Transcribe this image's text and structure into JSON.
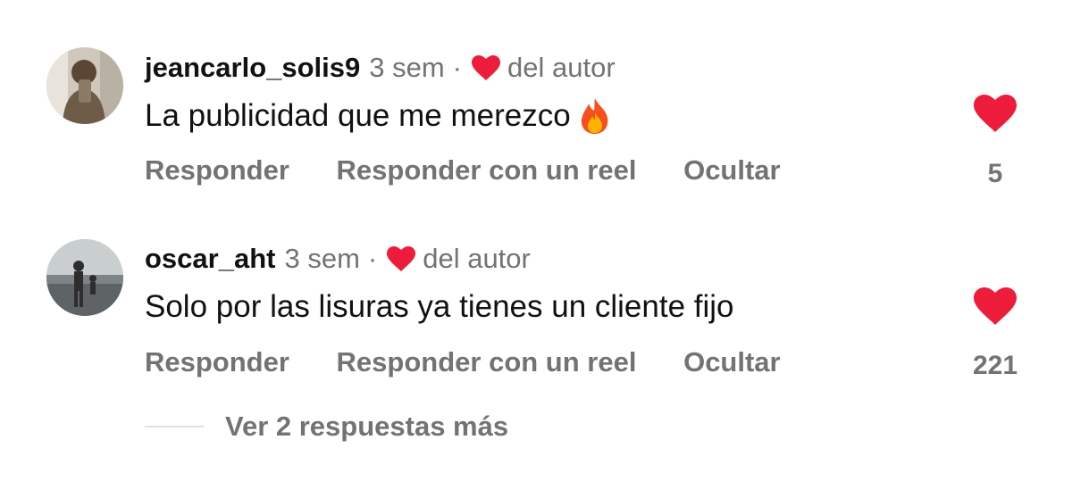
{
  "comments": [
    {
      "username": "jeancarlo_solis9",
      "time": "3 sem",
      "author_like_label": "del autor",
      "text": "La publicidad que me merezco",
      "emoji": "fire",
      "actions": {
        "reply": "Responder",
        "reply_reel": "Responder con un reel",
        "hide": "Ocultar"
      },
      "likes": "5",
      "liked": true
    },
    {
      "username": "oscar_aht",
      "time": "3 sem",
      "author_like_label": "del autor",
      "text": "Solo por las lisuras ya tienes un cliente fijo",
      "actions": {
        "reply": "Responder",
        "reply_reel": "Responder con un reel",
        "hide": "Ocultar"
      },
      "likes": "221",
      "liked": true
    }
  ],
  "view_replies_label": "Ver 2 respuestas más",
  "colors": {
    "heart": "#ED1C3A",
    "muted": "#737373",
    "text": "#111111"
  },
  "icons": {
    "like": "heart-icon",
    "author_like": "heart-icon",
    "emoji": "fire-icon"
  }
}
